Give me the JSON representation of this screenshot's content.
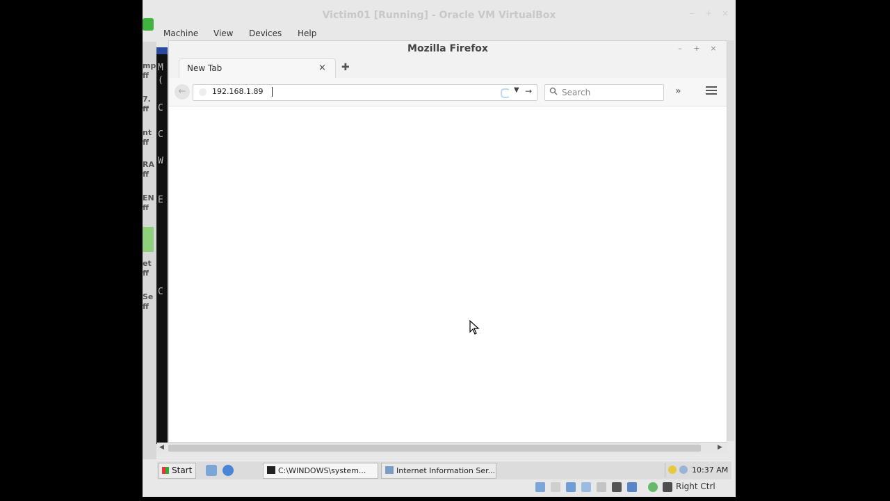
{
  "vbox": {
    "title": "Victim01 [Running] - Oracle VM VirtualBox",
    "menu": [
      "Machine",
      "View",
      "Devices",
      "Help"
    ],
    "buttons": [
      "–",
      "+",
      "×"
    ],
    "host_key": "Right Ctrl",
    "status_icons": [
      "hard-disk-icon",
      "optical-drive-icon",
      "usb-icon",
      "network-icon",
      "shared-folders-icon",
      "display-icon",
      "video-capture-icon",
      "cpu-icon",
      "mouse-integration-icon",
      "host-key-icon"
    ]
  },
  "guest": {
    "left_strip": [
      "mp",
      "ff",
      "7.",
      "ff",
      "nt",
      "ff",
      "RA",
      "ff",
      "EN",
      "ff",
      "et",
      "ff",
      "Se",
      "ff"
    ],
    "console_letters": [
      "M",
      "(",
      "C",
      "C",
      "W",
      "E",
      "C"
    ]
  },
  "firefox": {
    "title": "Mozilla Firefox",
    "window_buttons": [
      "–",
      "+",
      "×"
    ],
    "tab_label": "New Tab",
    "tab_close": "×",
    "new_tab": "✚",
    "back": "←",
    "url": "192.168.1.89",
    "url_dropdown": "▼",
    "go": "→",
    "search_placeholder": "Search",
    "search_icon": "🔍",
    "overflow": "»",
    "menu_icon": "hamburger-menu-icon"
  },
  "taskbar": {
    "start": "Start",
    "tasks": [
      {
        "label": "C:\\WINDOWS\\system...",
        "icon": "cmd-icon"
      },
      {
        "label": "Internet Information Ser...",
        "icon": "iis-icon"
      }
    ],
    "clock": "10:37 AM",
    "quicklaunch": [
      "show-desktop-icon",
      "ie-icon"
    ]
  },
  "colors": {
    "vbox_logo": "#3fb43f",
    "spinner": "#bcd8f0",
    "tray_shield": "#e8c83c"
  }
}
